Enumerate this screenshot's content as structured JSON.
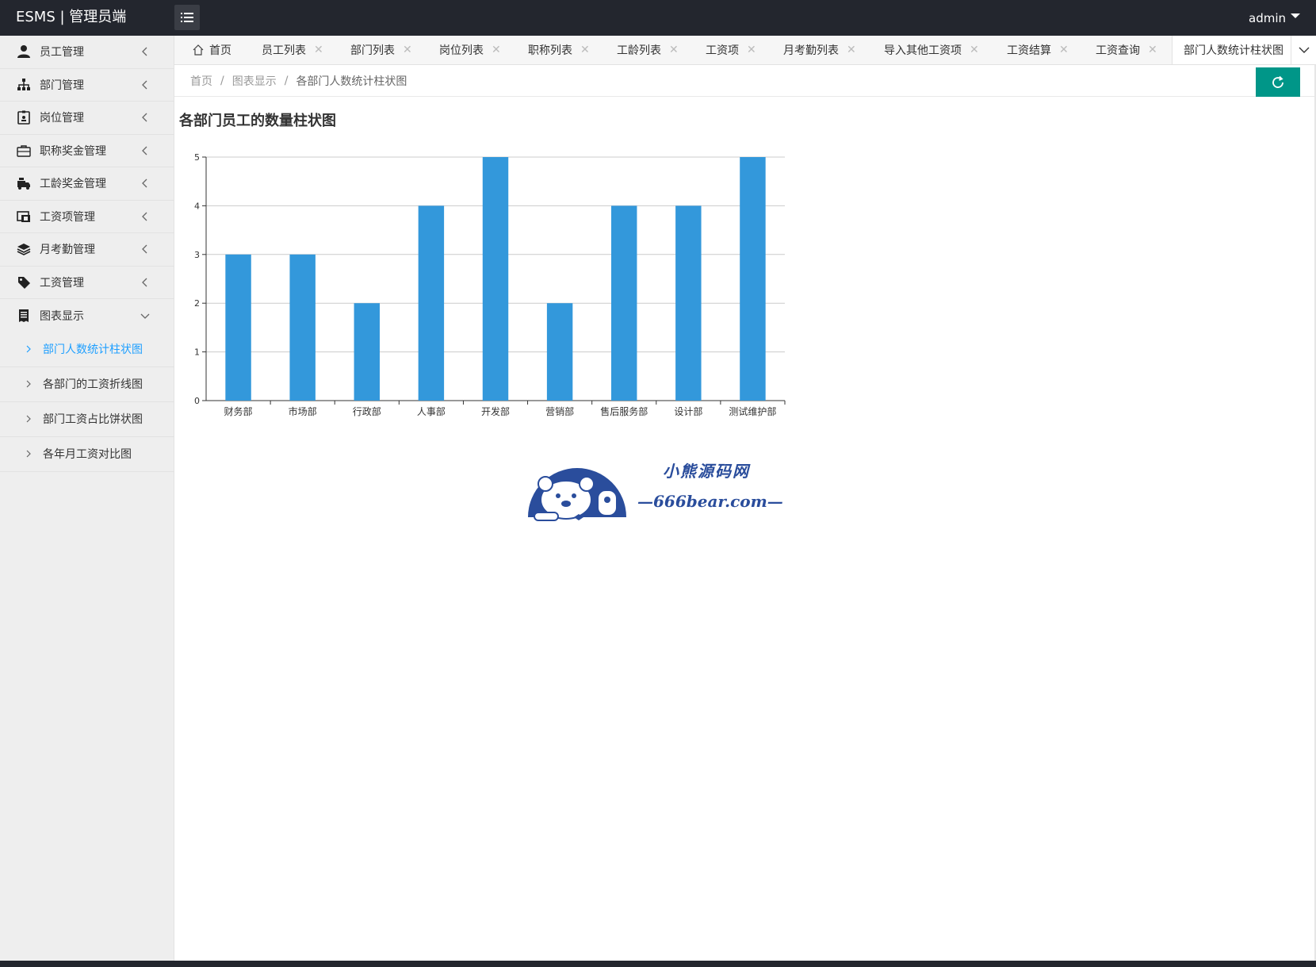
{
  "header": {
    "brand": "ESMS | 管理员端",
    "user": "admin"
  },
  "sidebar": {
    "items": [
      {
        "label": "员工管理",
        "icon": "user-icon"
      },
      {
        "label": "部门管理",
        "icon": "sitemap-icon"
      },
      {
        "label": "岗位管理",
        "icon": "badge-icon"
      },
      {
        "label": "职称奖金管理",
        "icon": "briefcase-icon"
      },
      {
        "label": "工龄奖金管理",
        "icon": "truck-icon"
      },
      {
        "label": "工资项管理",
        "icon": "money-icon"
      },
      {
        "label": "月考勤管理",
        "icon": "layers-icon"
      },
      {
        "label": "工资管理",
        "icon": "tags-icon"
      },
      {
        "label": "图表显示",
        "icon": "receipt-icon"
      }
    ],
    "subitems": [
      {
        "label": "部门人数统计柱状图"
      },
      {
        "label": "各部门的工资折线图"
      },
      {
        "label": "部门工资占比饼状图"
      },
      {
        "label": "各年月工资对比图"
      }
    ]
  },
  "tabs": [
    {
      "label": "首页"
    },
    {
      "label": "员工列表"
    },
    {
      "label": "部门列表"
    },
    {
      "label": "岗位列表"
    },
    {
      "label": "职称列表"
    },
    {
      "label": "工龄列表"
    },
    {
      "label": "工资项"
    },
    {
      "label": "月考勤列表"
    },
    {
      "label": "导入其他工资项"
    },
    {
      "label": "工资结算"
    },
    {
      "label": "工资查询"
    },
    {
      "label": "部门人数统计柱状图"
    }
  ],
  "breadcrumb": {
    "home": "首页",
    "section": "图表显示",
    "current": "各部门人数统计柱状图"
  },
  "colors": {
    "header_bg": "#23262e",
    "bar": "#3398db",
    "accent": "#009688",
    "active_link": "#1e9fff"
  },
  "chart_data": {
    "type": "bar",
    "title": "各部门员工的数量柱状图",
    "categories": [
      "财务部",
      "市场部",
      "行政部",
      "人事部",
      "开发部",
      "营销部",
      "售后服务部",
      "设计部",
      "测试维护部"
    ],
    "values": [
      3,
      3,
      2,
      4,
      5,
      2,
      4,
      4,
      5
    ],
    "ylim": [
      0,
      5
    ],
    "yticks": [
      0,
      1,
      2,
      3,
      4,
      5
    ],
    "grid": true,
    "xlabel": "",
    "ylabel": ""
  },
  "logo": {
    "line1": "小熊源码网",
    "line2": "—666bear.com—"
  }
}
